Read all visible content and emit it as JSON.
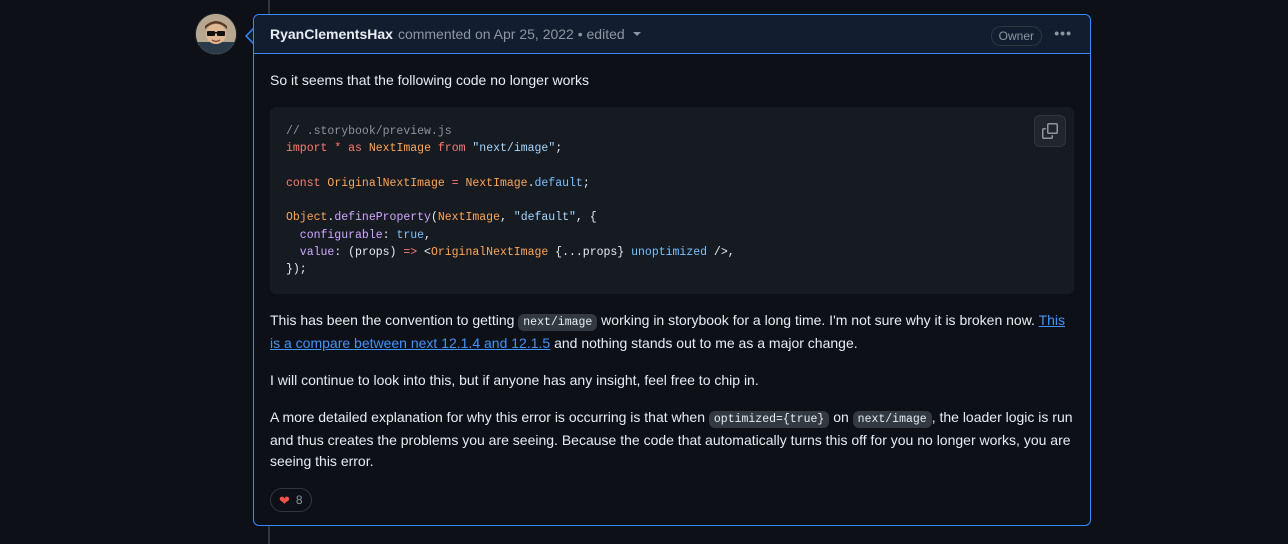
{
  "comment": {
    "author": "RyanClementsHax",
    "meta": "commented on Apr 25, 2022 • edited",
    "badge": "Owner",
    "menu_icon": "kebab-horizontal-icon",
    "intro": "So it seems that the following code no longer works",
    "code_lines": [
      [
        {
          "t": "// .storybook/preview.js",
          "c": "c-comment"
        }
      ],
      [
        {
          "t": "import",
          "c": "c-kw"
        },
        {
          "t": " ",
          "c": "c-plain"
        },
        {
          "t": "*",
          "c": "c-kw"
        },
        {
          "t": " ",
          "c": "c-plain"
        },
        {
          "t": "as",
          "c": "c-kw"
        },
        {
          "t": " ",
          "c": "c-plain"
        },
        {
          "t": "NextImage",
          "c": "c-ent"
        },
        {
          "t": " ",
          "c": "c-plain"
        },
        {
          "t": "from",
          "c": "c-kw"
        },
        {
          "t": " ",
          "c": "c-plain"
        },
        {
          "t": "\"next/image\"",
          "c": "c-str"
        },
        {
          "t": ";",
          "c": "c-plain"
        }
      ],
      [],
      [
        {
          "t": "const",
          "c": "c-kw"
        },
        {
          "t": " ",
          "c": "c-plain"
        },
        {
          "t": "OriginalNextImage",
          "c": "c-ent"
        },
        {
          "t": " ",
          "c": "c-plain"
        },
        {
          "t": "=",
          "c": "c-kw"
        },
        {
          "t": " ",
          "c": "c-plain"
        },
        {
          "t": "NextImage",
          "c": "c-ent"
        },
        {
          "t": ".",
          "c": "c-plain"
        },
        {
          "t": "default",
          "c": "c-const"
        },
        {
          "t": ";",
          "c": "c-plain"
        }
      ],
      [],
      [
        {
          "t": "Object",
          "c": "c-ent"
        },
        {
          "t": ".",
          "c": "c-plain"
        },
        {
          "t": "defineProperty",
          "c": "c-prop"
        },
        {
          "t": "(",
          "c": "c-plain"
        },
        {
          "t": "NextImage",
          "c": "c-ent"
        },
        {
          "t": ", ",
          "c": "c-plain"
        },
        {
          "t": "\"default\"",
          "c": "c-str"
        },
        {
          "t": ", {",
          "c": "c-plain"
        }
      ],
      [
        {
          "t": "  configurable",
          "c": "c-prop"
        },
        {
          "t": ": ",
          "c": "c-plain"
        },
        {
          "t": "true",
          "c": "c-const"
        },
        {
          "t": ",",
          "c": "c-plain"
        }
      ],
      [
        {
          "t": "  value",
          "c": "c-prop"
        },
        {
          "t": ": (props) ",
          "c": "c-plain"
        },
        {
          "t": "=>",
          "c": "c-kw"
        },
        {
          "t": " <",
          "c": "c-plain"
        },
        {
          "t": "OriginalNextImage",
          "c": "c-ent"
        },
        {
          "t": " {...props} ",
          "c": "c-plain"
        },
        {
          "t": "unoptimized",
          "c": "c-const"
        },
        {
          "t": " />,",
          "c": "c-plain"
        }
      ],
      [
        {
          "t": "});",
          "c": "c-plain"
        }
      ]
    ],
    "copy_icon": "copy-icon",
    "para1_a": "This has been the convention to getting ",
    "para1_code": "next/image",
    "para1_b": " working in storybook for a long time. I'm not sure why it is broken now. ",
    "para1_link": "This is a compare between next 12.1.4 and 12.1.5",
    "para1_c": " and nothing stands out to me as a major change.",
    "para2": "I will continue to look into this, but if anyone has any insight, feel free to chip in.",
    "para3_a": "A more detailed explanation for why this error is occurring is that when ",
    "para3_code1": "optimized={true}",
    "para3_b": " on ",
    "para3_code2": "next/image",
    "para3_c": ", the loader logic is run and thus creates the problems you are seeing. Because the code that automatically turns this off for you no longer works, you are seeing this error.",
    "reaction_icon": "heart-icon",
    "reaction_count": "8"
  }
}
